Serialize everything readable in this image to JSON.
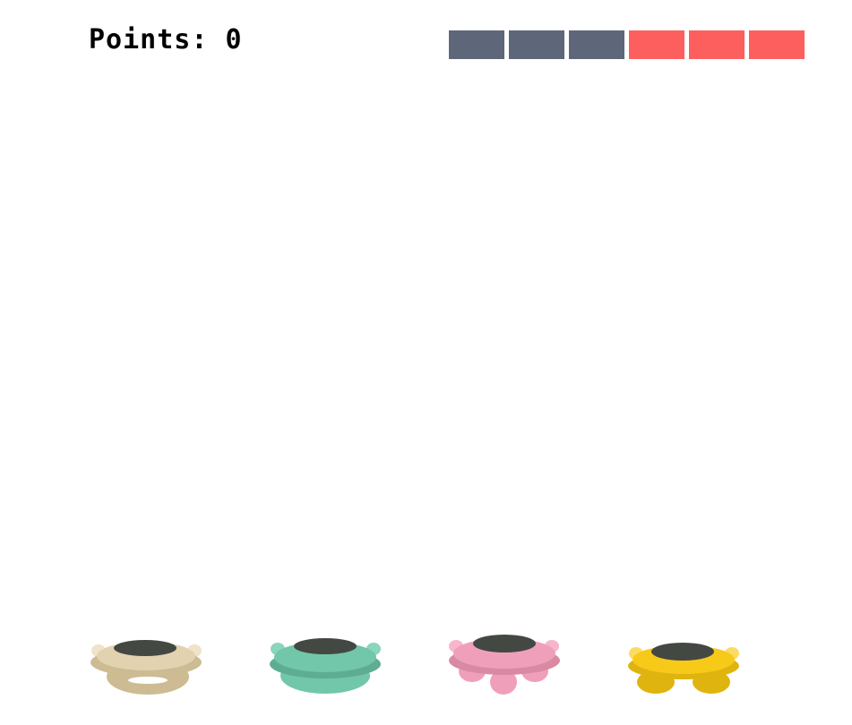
{
  "hud": {
    "points_label": "Points:",
    "points_value": "0"
  },
  "lives": {
    "total": 6,
    "lost": 3,
    "remaining": 3,
    "lost_color": "#5d6779",
    "remaining_color": "#fd5f5f"
  },
  "creatures": [
    {
      "name": "tan",
      "body_color": "#e2d2b0",
      "shade_color": "#cdbb93",
      "ear_color": "#efe3c9",
      "mouth_color": "#434843"
    },
    {
      "name": "green",
      "body_color": "#72c6aa",
      "shade_color": "#5ead92",
      "ear_color": "#8ad6bc",
      "mouth_color": "#434843"
    },
    {
      "name": "pink",
      "body_color": "#f09fba",
      "shade_color": "#d98aa3",
      "ear_color": "#f7b6cb",
      "mouth_color": "#434843"
    },
    {
      "name": "yellow",
      "body_color": "#f7c919",
      "shade_color": "#dfb40f",
      "ear_color": "#fbdc62",
      "mouth_color": "#434843"
    }
  ]
}
